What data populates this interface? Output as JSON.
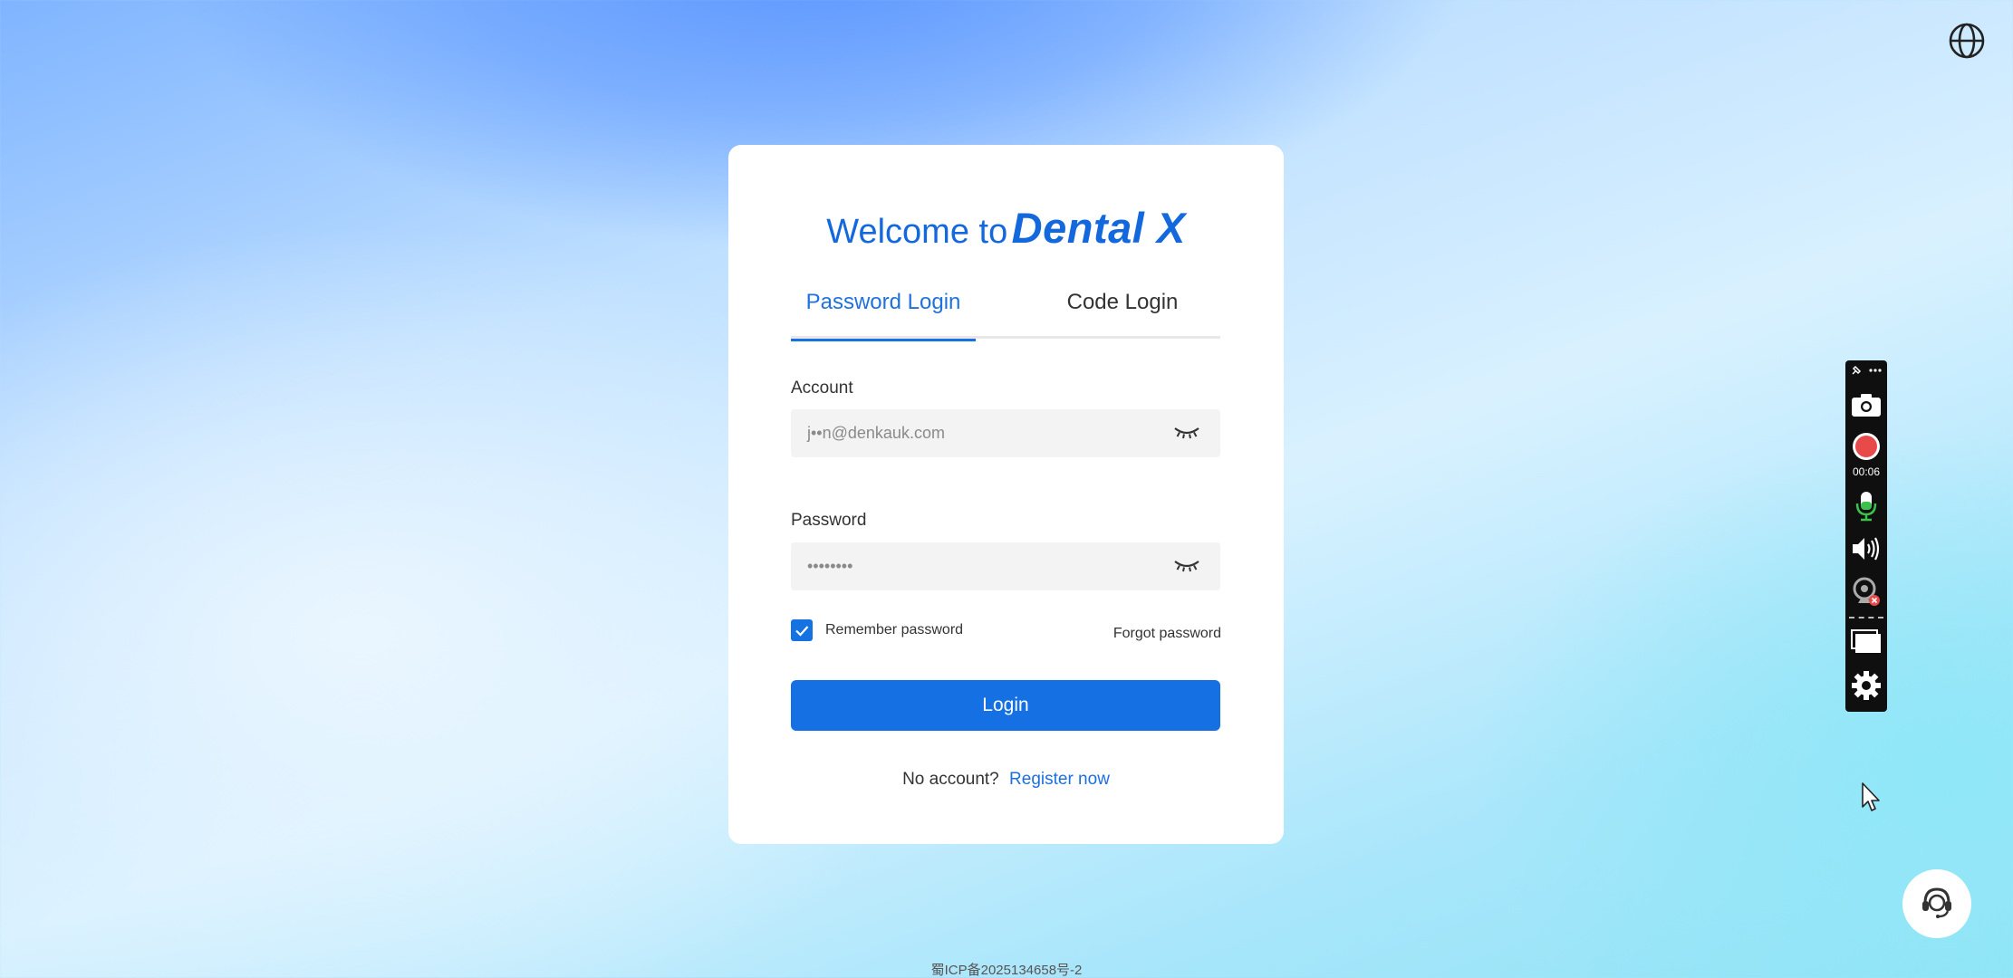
{
  "language": {
    "icon": "globe-icon"
  },
  "card": {
    "title_welcome": "Welcome to",
    "title_brand": "Dental X",
    "tabs": [
      {
        "label": "Password Login",
        "active": true
      },
      {
        "label": "Code Login",
        "active": false
      }
    ],
    "account": {
      "label": "Account",
      "value": "j••n@denkauk.com",
      "toggle_icon": "eye-closed-icon"
    },
    "password": {
      "label": "Password",
      "value": "••••••••",
      "toggle_icon": "eye-closed-icon"
    },
    "remember": {
      "label": "Remember password",
      "checked": true
    },
    "forgot_label": "Forgot password",
    "login_label": "Login",
    "no_account_text": "No account?",
    "register_label": "Register now"
  },
  "recorder": {
    "items": [
      "pin-icon",
      "more-icon",
      "camera-icon",
      "record-icon",
      "microphone-icon",
      "speaker-icon",
      "webcam-off-icon",
      "window-icon",
      "gear-icon"
    ],
    "elapsed": "00:06"
  },
  "support": {
    "icon": "headset-icon"
  },
  "footer": {
    "icp": "蜀ICP备2025134658号-2"
  },
  "colors": {
    "primary": "#1570e4",
    "brand": "#1268dc",
    "record": "#e84a4a",
    "mic": "#3cc24a"
  }
}
